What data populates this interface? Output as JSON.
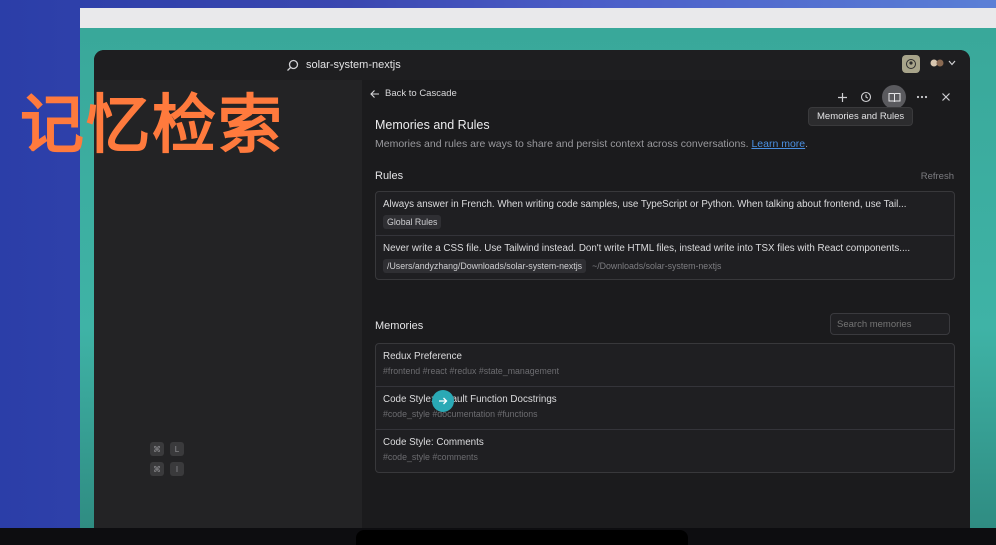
{
  "overlay_title": "记忆检索",
  "titlebar": {
    "search_text": "solar-system-nextjs"
  },
  "left_pane": {
    "shortcuts": [
      {
        "mod": "⌘",
        "key": "L"
      },
      {
        "mod": "⌘",
        "key": "I"
      }
    ]
  },
  "panel": {
    "back_label": "Back to Cascade",
    "tooltip": "Memories and Rules",
    "title": "Memories and Rules",
    "description": "Memories and rules are ways to share and persist context across conversations.",
    "learn_more": "Learn more",
    "description_end": ".",
    "rules_label": "Rules",
    "refresh_label": "Refresh",
    "rules": [
      {
        "text": "Always answer in French. When writing code samples, use TypeScript or Python. When talking about frontend, use Tail...",
        "chip": "Global Rules",
        "path": ""
      },
      {
        "text": "Never write a CSS file. Use Tailwind instead. Don't write HTML files, instead write into TSX files with React components....",
        "chip": "/Users/andyzhang/Downloads/solar-system-nextjs",
        "path": "~/Downloads/solar-system-nextjs"
      }
    ],
    "memories_label": "Memories",
    "search_placeholder": "Search memories",
    "memories": [
      {
        "title": "Redux Preference",
        "tags": "#frontend #react #redux #state_management"
      },
      {
        "title": "Code Style: Default Function Docstrings",
        "tags": "#code_style #documentation #functions"
      },
      {
        "title": "Code Style: Comments",
        "tags": "#code_style #comments"
      }
    ]
  },
  "colors": {
    "accent": "#4a90e2",
    "overlay": "#ff7a3d",
    "teal": "#3fb3a6",
    "cursor": "#2aa9b5"
  }
}
